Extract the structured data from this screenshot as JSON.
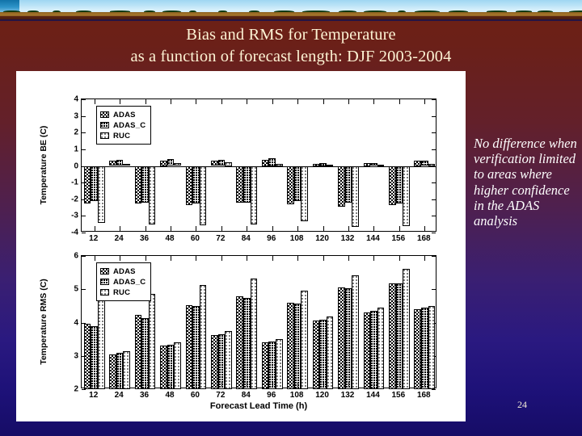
{
  "slide": {
    "title_line1": "Bias and RMS for Temperature",
    "title_line2": "as a function of forecast length: DJF 2003-2004",
    "side_note": "No difference when verification limited to areas where higher confidence in the ADAS analysis",
    "page_number": "24",
    "colors": {
      "title_text": "#fdf3d4",
      "note_text": "#ffffff",
      "bg_top": "#6d1f14",
      "bg_bottom": "#160c66",
      "panel": "#ffffff"
    }
  },
  "chart_data": [
    {
      "type": "bar",
      "id": "bias",
      "title": "",
      "xlabel": "",
      "ylabel": "Temperature BE (C)",
      "ylim": [
        -4,
        4
      ],
      "yticks": [
        4,
        3,
        2,
        1,
        0,
        -1,
        -2,
        -3,
        -4
      ],
      "grid": false,
      "legend": [
        "ADAS",
        "ADAS_C",
        "RUC"
      ],
      "legend_position": "upper-left",
      "categories": [
        "12",
        "24",
        "36",
        "48",
        "60",
        "72",
        "84",
        "96",
        "108",
        "120",
        "132",
        "144",
        "156",
        "168"
      ],
      "xtick_labels": [
        "12",
        "24",
        "36",
        "48",
        "60",
        "72",
        "84",
        "96",
        "108",
        "120",
        "132",
        "144",
        "156",
        "168"
      ],
      "series": [
        {
          "name": "ADAS",
          "values": [
            -2.25,
            0.32,
            -2.25,
            0.3,
            -2.35,
            0.32,
            -2.2,
            0.35,
            -2.3,
            0.1,
            -2.45,
            0.15,
            -2.35,
            0.3
          ]
        },
        {
          "name": "ADAS_C",
          "values": [
            -2.1,
            0.38,
            -2.2,
            0.42,
            -2.25,
            0.38,
            -2.2,
            0.45,
            -2.1,
            0.15,
            -2.2,
            0.18,
            -2.25,
            0.32
          ]
        },
        {
          "name": "RUC",
          "values": [
            -3.4,
            0.12,
            -3.5,
            0.18,
            -3.55,
            0.2,
            -3.5,
            0.1,
            -3.3,
            0.08,
            -3.65,
            0.05,
            -3.6,
            0.1
          ]
        }
      ]
    },
    {
      "type": "bar",
      "id": "rms",
      "title": "",
      "xlabel": "Forecast Lead Time (h)",
      "ylabel": "Temperature RMS (C)",
      "ylim": [
        2,
        6
      ],
      "yticks": [
        6,
        5,
        4,
        3,
        2
      ],
      "grid": false,
      "legend": [
        "ADAS",
        "ADAS_C",
        "RUC"
      ],
      "legend_position": "upper-left",
      "categories": [
        "12",
        "24",
        "36",
        "48",
        "60",
        "72",
        "84",
        "96",
        "108",
        "120",
        "132",
        "144",
        "156",
        "168"
      ],
      "xtick_labels": [
        "12",
        "24",
        "36",
        "48",
        "60",
        "72",
        "84",
        "96",
        "108",
        "120",
        "132",
        "144",
        "156",
        "168"
      ],
      "series": [
        {
          "name": "ADAS",
          "values": [
            3.97,
            3.05,
            4.22,
            3.3,
            4.53,
            3.62,
            4.78,
            3.4,
            4.6,
            4.05,
            5.05,
            4.3,
            5.18,
            4.4
          ]
        },
        {
          "name": "ADAS_C",
          "values": [
            3.9,
            3.08,
            4.14,
            3.34,
            4.49,
            3.66,
            4.75,
            3.44,
            4.58,
            4.08,
            5.02,
            4.35,
            5.18,
            4.45
          ]
        },
        {
          "name": "RUC",
          "values": [
            4.67,
            3.14,
            4.87,
            3.41,
            5.12,
            3.74,
            5.32,
            3.5,
            4.95,
            4.18,
            5.42,
            4.45,
            5.62,
            4.5
          ]
        }
      ]
    }
  ]
}
